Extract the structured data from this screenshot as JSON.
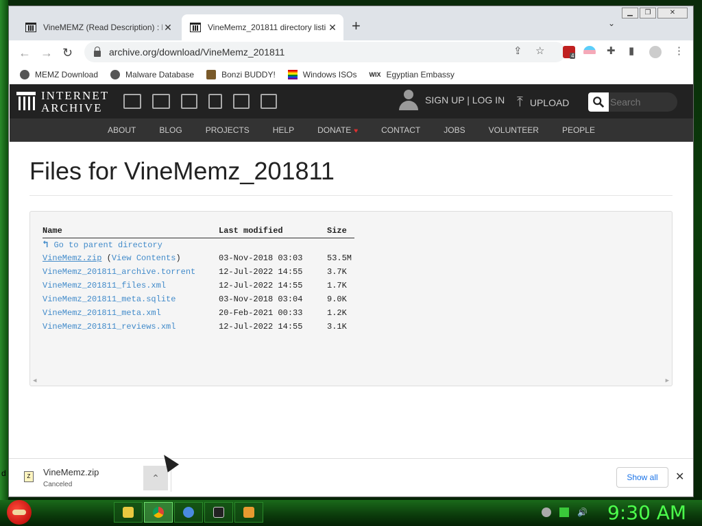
{
  "desktop": {
    "edge_letter": "d"
  },
  "tabs": [
    {
      "title": "VineMEMZ (Read Description) : F",
      "active": false
    },
    {
      "title": "VineMemz_201811 directory listi",
      "active": true
    }
  ],
  "toolbar": {
    "url": "archive.org/download/VineMemz_201811",
    "extension_badge": "4"
  },
  "bookmarks": [
    {
      "label": "MEMZ Download",
      "icon": "globe-icon"
    },
    {
      "label": "Malware Database",
      "icon": "globe-icon"
    },
    {
      "label": "Bonzi BUDDY!",
      "icon": "bonzi-icon"
    },
    {
      "label": "Windows ISOs",
      "icon": "rainbow-flag-icon"
    },
    {
      "label": "Egyptian Embassy",
      "icon": "wix-icon"
    }
  ],
  "ia": {
    "logo_line1": "INTERNET",
    "logo_line2": "ARCHIVE",
    "signin": "SIGN UP | LOG IN",
    "upload": "UPLOAD",
    "search_placeholder": "Search",
    "nav": [
      "ABOUT",
      "BLOG",
      "PROJECTS",
      "HELP",
      "DONATE",
      "CONTACT",
      "JOBS",
      "VOLUNTEER",
      "PEOPLE"
    ]
  },
  "page": {
    "title": "Files for VineMemz_201811"
  },
  "listing": {
    "headers": {
      "name": "Name",
      "modified": "Last modified",
      "size": "Size"
    },
    "parent": "Go to parent directory",
    "files": [
      {
        "name": "VineMemz.zip",
        "extra": "View Contents",
        "modified": "03-Nov-2018 03:03",
        "size": "53.5M"
      },
      {
        "name": "VineMemz_201811_archive.torrent",
        "modified": "12-Jul-2022 14:55",
        "size": "3.7K"
      },
      {
        "name": "VineMemz_201811_files.xml",
        "modified": "12-Jul-2022 14:55",
        "size": "1.7K"
      },
      {
        "name": "VineMemz_201811_meta.sqlite",
        "modified": "03-Nov-2018 03:04",
        "size": "9.0K"
      },
      {
        "name": "VineMemz_201811_meta.xml",
        "modified": "20-Feb-2021 00:33",
        "size": "1.2K"
      },
      {
        "name": "VineMemz_201811_reviews.xml",
        "modified": "12-Jul-2022 14:55",
        "size": "3.1K"
      }
    ]
  },
  "download": {
    "filename": "VineMemz.zip",
    "status": "Canceled",
    "show_all": "Show all",
    "icon_text": "Z"
  },
  "taskbar": {
    "clock": "9:30 AM"
  },
  "colors": {
    "link": "#428bca",
    "clock": "#4cff4c",
    "ia_header": "#222222"
  }
}
